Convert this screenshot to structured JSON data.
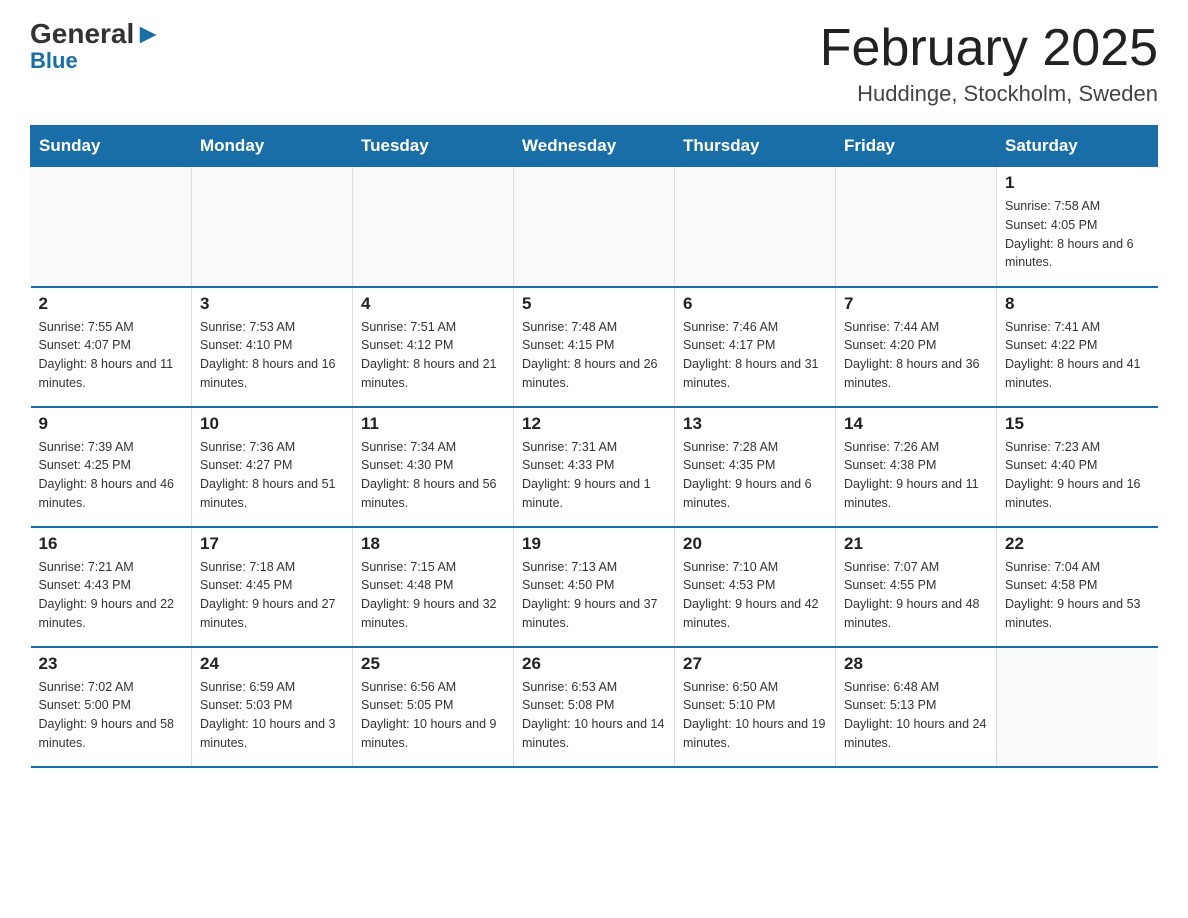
{
  "logo": {
    "general": "General",
    "blue": "Blue"
  },
  "title": "February 2025",
  "location": "Huddinge, Stockholm, Sweden",
  "days_of_week": [
    "Sunday",
    "Monday",
    "Tuesday",
    "Wednesday",
    "Thursday",
    "Friday",
    "Saturday"
  ],
  "weeks": [
    [
      {
        "day": "",
        "info": ""
      },
      {
        "day": "",
        "info": ""
      },
      {
        "day": "",
        "info": ""
      },
      {
        "day": "",
        "info": ""
      },
      {
        "day": "",
        "info": ""
      },
      {
        "day": "",
        "info": ""
      },
      {
        "day": "1",
        "info": "Sunrise: 7:58 AM\nSunset: 4:05 PM\nDaylight: 8 hours and 6 minutes."
      }
    ],
    [
      {
        "day": "2",
        "info": "Sunrise: 7:55 AM\nSunset: 4:07 PM\nDaylight: 8 hours and 11 minutes."
      },
      {
        "day": "3",
        "info": "Sunrise: 7:53 AM\nSunset: 4:10 PM\nDaylight: 8 hours and 16 minutes."
      },
      {
        "day": "4",
        "info": "Sunrise: 7:51 AM\nSunset: 4:12 PM\nDaylight: 8 hours and 21 minutes."
      },
      {
        "day": "5",
        "info": "Sunrise: 7:48 AM\nSunset: 4:15 PM\nDaylight: 8 hours and 26 minutes."
      },
      {
        "day": "6",
        "info": "Sunrise: 7:46 AM\nSunset: 4:17 PM\nDaylight: 8 hours and 31 minutes."
      },
      {
        "day": "7",
        "info": "Sunrise: 7:44 AM\nSunset: 4:20 PM\nDaylight: 8 hours and 36 minutes."
      },
      {
        "day": "8",
        "info": "Sunrise: 7:41 AM\nSunset: 4:22 PM\nDaylight: 8 hours and 41 minutes."
      }
    ],
    [
      {
        "day": "9",
        "info": "Sunrise: 7:39 AM\nSunset: 4:25 PM\nDaylight: 8 hours and 46 minutes."
      },
      {
        "day": "10",
        "info": "Sunrise: 7:36 AM\nSunset: 4:27 PM\nDaylight: 8 hours and 51 minutes."
      },
      {
        "day": "11",
        "info": "Sunrise: 7:34 AM\nSunset: 4:30 PM\nDaylight: 8 hours and 56 minutes."
      },
      {
        "day": "12",
        "info": "Sunrise: 7:31 AM\nSunset: 4:33 PM\nDaylight: 9 hours and 1 minute."
      },
      {
        "day": "13",
        "info": "Sunrise: 7:28 AM\nSunset: 4:35 PM\nDaylight: 9 hours and 6 minutes."
      },
      {
        "day": "14",
        "info": "Sunrise: 7:26 AM\nSunset: 4:38 PM\nDaylight: 9 hours and 11 minutes."
      },
      {
        "day": "15",
        "info": "Sunrise: 7:23 AM\nSunset: 4:40 PM\nDaylight: 9 hours and 16 minutes."
      }
    ],
    [
      {
        "day": "16",
        "info": "Sunrise: 7:21 AM\nSunset: 4:43 PM\nDaylight: 9 hours and 22 minutes."
      },
      {
        "day": "17",
        "info": "Sunrise: 7:18 AM\nSunset: 4:45 PM\nDaylight: 9 hours and 27 minutes."
      },
      {
        "day": "18",
        "info": "Sunrise: 7:15 AM\nSunset: 4:48 PM\nDaylight: 9 hours and 32 minutes."
      },
      {
        "day": "19",
        "info": "Sunrise: 7:13 AM\nSunset: 4:50 PM\nDaylight: 9 hours and 37 minutes."
      },
      {
        "day": "20",
        "info": "Sunrise: 7:10 AM\nSunset: 4:53 PM\nDaylight: 9 hours and 42 minutes."
      },
      {
        "day": "21",
        "info": "Sunrise: 7:07 AM\nSunset: 4:55 PM\nDaylight: 9 hours and 48 minutes."
      },
      {
        "day": "22",
        "info": "Sunrise: 7:04 AM\nSunset: 4:58 PM\nDaylight: 9 hours and 53 minutes."
      }
    ],
    [
      {
        "day": "23",
        "info": "Sunrise: 7:02 AM\nSunset: 5:00 PM\nDaylight: 9 hours and 58 minutes."
      },
      {
        "day": "24",
        "info": "Sunrise: 6:59 AM\nSunset: 5:03 PM\nDaylight: 10 hours and 3 minutes."
      },
      {
        "day": "25",
        "info": "Sunrise: 6:56 AM\nSunset: 5:05 PM\nDaylight: 10 hours and 9 minutes."
      },
      {
        "day": "26",
        "info": "Sunrise: 6:53 AM\nSunset: 5:08 PM\nDaylight: 10 hours and 14 minutes."
      },
      {
        "day": "27",
        "info": "Sunrise: 6:50 AM\nSunset: 5:10 PM\nDaylight: 10 hours and 19 minutes."
      },
      {
        "day": "28",
        "info": "Sunrise: 6:48 AM\nSunset: 5:13 PM\nDaylight: 10 hours and 24 minutes."
      },
      {
        "day": "",
        "info": ""
      }
    ]
  ]
}
